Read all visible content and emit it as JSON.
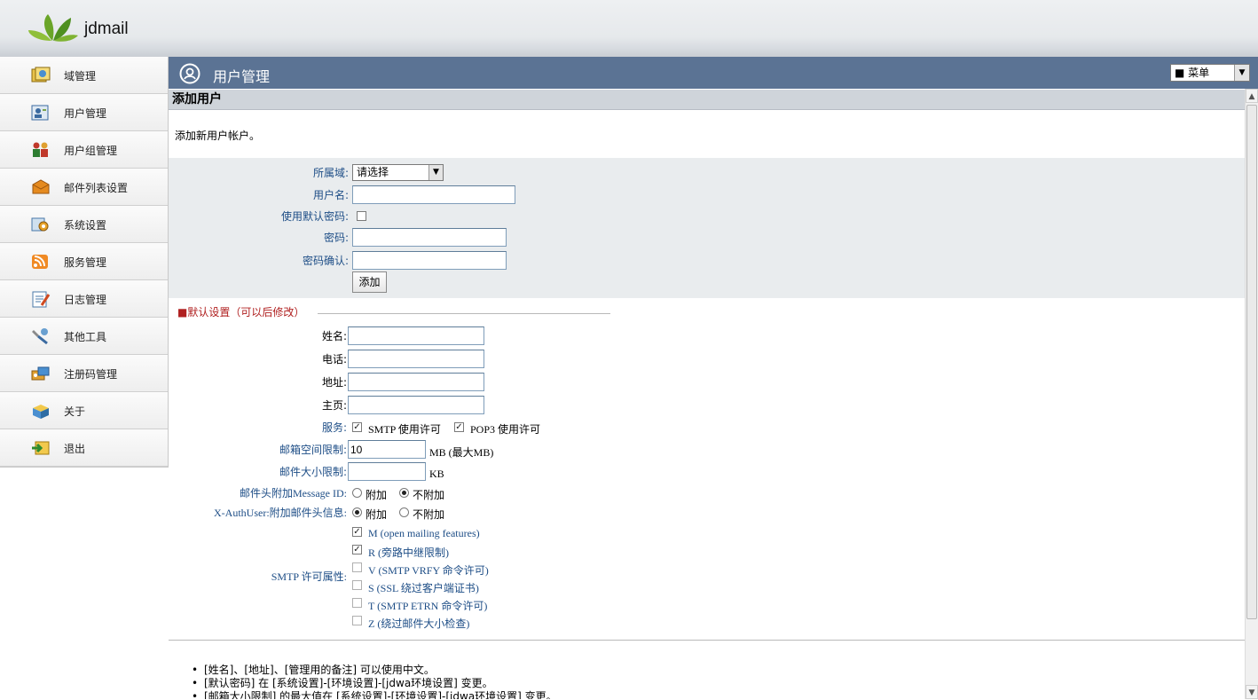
{
  "header": {
    "logo_text": "jdmail"
  },
  "sidebar": {
    "items": [
      {
        "label": "域管理",
        "icon": "domain-icon"
      },
      {
        "label": "用户管理",
        "icon": "user-icon"
      },
      {
        "label": "用户组管理",
        "icon": "group-icon"
      },
      {
        "label": "邮件列表设置",
        "icon": "mailing-list-icon"
      },
      {
        "label": "系统设置",
        "icon": "system-settings-icon"
      },
      {
        "label": "服务管理",
        "icon": "service-icon"
      },
      {
        "label": "日志管理",
        "icon": "log-icon"
      },
      {
        "label": "其他工具",
        "icon": "tools-icon"
      },
      {
        "label": "注册码管理",
        "icon": "registration-icon"
      },
      {
        "label": "关于",
        "icon": "about-icon"
      },
      {
        "label": "退出",
        "icon": "logout-icon"
      }
    ]
  },
  "main": {
    "title": "用户管理",
    "menu_select": "■ 菜单",
    "section_title": "添加用户",
    "description": "添加新用户帐户。",
    "form": {
      "domain_label": "所属域:",
      "domain_value": "请选择",
      "username_label": "用户名:",
      "username_value": "",
      "default_pwd_label": "使用默认密码:",
      "password_label": "密码:",
      "password_value": "",
      "password_confirm_label": "密码确认:",
      "password_confirm_value": "",
      "add_button": "添加"
    },
    "defaults": {
      "legend": "■默认设置（可以后修改）",
      "name_label": "姓名:",
      "phone_label": "电话:",
      "address_label": "地址:",
      "homepage_label": "主页:",
      "service_label": "服务:",
      "smtp_permit": "SMTP 使用许可",
      "pop3_permit": "POP3 使用许可",
      "mailbox_limit_label": "邮箱空间限制:",
      "mailbox_limit_value": "10",
      "mailbox_limit_unit": "MB (最大MB)",
      "mail_size_label": "邮件大小限制:",
      "mail_size_value": "",
      "mail_size_unit": "KB",
      "message_id_label": "邮件头附加Message ID:",
      "message_id_opt_add": "附加",
      "message_id_opt_noadd": "不附加",
      "authuser_label": "X-AuthUser:附加邮件头信息:",
      "authuser_opt_add": "附加",
      "authuser_opt_noadd": "不附加",
      "smtp_attr_label": "SMTP 许可属性:",
      "smtp_attrs": [
        {
          "label": "M (open mailing features)",
          "checked": true
        },
        {
          "label": "R (旁路中继限制)",
          "checked": true
        },
        {
          "label": "V (SMTP VRFY 命令许可)",
          "checked": false
        },
        {
          "label": "S (SSL 绕过客户端证书)",
          "checked": false
        },
        {
          "label": "T (SMTP ETRN 命令许可)",
          "checked": false
        },
        {
          "label": "Z (绕过邮件大小检查)",
          "checked": false
        }
      ]
    },
    "notes": [
      "[姓名]、[地址]、[管理用的备注] 可以使用中文。",
      "[默认密码] 在 [系统设置]-[环境设置]-[jdwa环境设置] 变更。",
      "[邮箱大小限制] 的最大值在 [系统设置]-[环境设置]-[jdwa环境设置] 变更。"
    ]
  }
}
